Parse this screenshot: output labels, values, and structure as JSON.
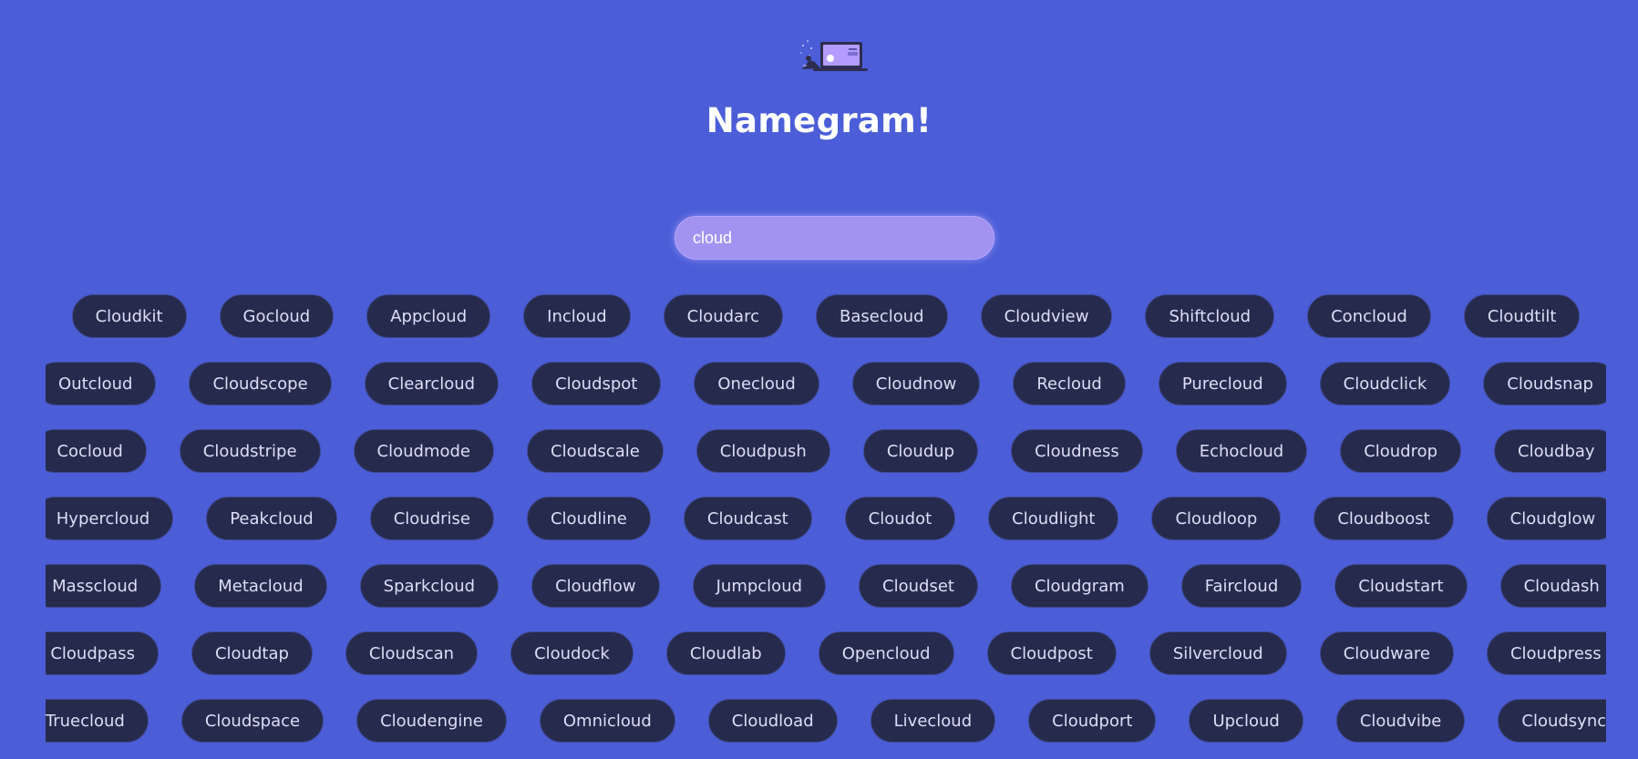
{
  "header": {
    "logo_icon": "laptop-illustration-icon",
    "title": "Namegram!"
  },
  "search": {
    "value": "cloud"
  },
  "colors": {
    "background": "#4b5ed8",
    "search_fill": "#a393f1",
    "chip_fill": "#262a4c",
    "chip_text": "#dcdff6",
    "title_text": "#ffffff"
  },
  "results": [
    [
      "Cloudkit",
      "Gocloud",
      "Appcloud",
      "Incloud",
      "Cloudarc",
      "Basecloud",
      "Cloudview",
      "Shiftcloud",
      "Concloud",
      "Cloudtilt"
    ],
    [
      "Outcloud",
      "Cloudscope",
      "Clearcloud",
      "Cloudspot",
      "Onecloud",
      "Cloudnow",
      "Recloud",
      "Purecloud",
      "Cloudclick",
      "Cloudsnap"
    ],
    [
      "Cocloud",
      "Cloudstripe",
      "Cloudmode",
      "Cloudscale",
      "Cloudpush",
      "Cloudup",
      "Cloudness",
      "Echocloud",
      "Cloudrop",
      "Cloudbay"
    ],
    [
      "Hypercloud",
      "Peakcloud",
      "Cloudrise",
      "Cloudline",
      "Cloudcast",
      "Cloudot",
      "Cloudlight",
      "Cloudloop",
      "Cloudboost",
      "Cloudglow"
    ],
    [
      "Masscloud",
      "Metacloud",
      "Sparkcloud",
      "Cloudflow",
      "Jumpcloud",
      "Cloudset",
      "Cloudgram",
      "Faircloud",
      "Cloudstart",
      "Cloudash"
    ],
    [
      "Cloudpass",
      "Cloudtap",
      "Cloudscan",
      "Cloudock",
      "Cloudlab",
      "Opencloud",
      "Cloudpost",
      "Silvercloud",
      "Cloudware",
      "Cloudpress"
    ],
    [
      "Truecloud",
      "Cloudspace",
      "Cloudengine",
      "Omnicloud",
      "Cloudload",
      "Livecloud",
      "Cloudport",
      "Upcloud",
      "Cloudvibe",
      "Cloudsync"
    ]
  ]
}
